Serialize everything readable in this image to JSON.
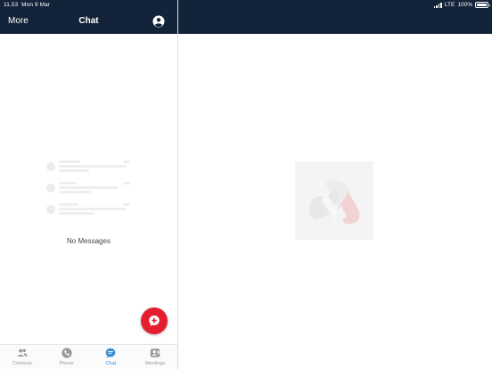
{
  "status_bar": {
    "time": "11.53",
    "date": "Mon 9 Mar",
    "network": "LTE",
    "battery": "100%",
    "battery_level": 1.0
  },
  "nav": {
    "more_label": "More",
    "title": "Chat",
    "profile_icon": "user-circle-icon"
  },
  "chat_list": {
    "empty_text": "No Messages"
  },
  "fab": {
    "icon": "new-chat-icon",
    "color": "#e41e2e"
  },
  "tabs": [
    {
      "label": "Contacts",
      "icon": "contacts-icon",
      "active": false
    },
    {
      "label": "Phone",
      "icon": "phone-icon",
      "active": false
    },
    {
      "label": "Chat",
      "icon": "chat-icon",
      "active": true
    },
    {
      "label": "Meetings",
      "icon": "meetings-icon",
      "active": false
    }
  ],
  "colors": {
    "header_bg": "#13233a",
    "accent_active": "#3a8fd6",
    "tab_inactive": "#9a9a9a"
  }
}
